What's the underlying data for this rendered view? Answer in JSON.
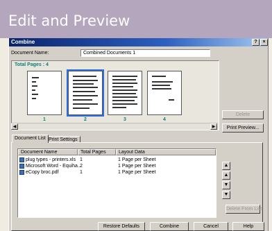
{
  "banner": {
    "title": "Edit and Preview"
  },
  "dialog": {
    "title": "Combine",
    "help_btn": "?",
    "close_btn": "×",
    "document_name_label": "Document Name:",
    "document_name_value": "Combined Documents 1",
    "total_pages_label": "Total Pages : 4",
    "thumbnails": [
      {
        "number": "1"
      },
      {
        "number": "2"
      },
      {
        "number": "3"
      },
      {
        "number": "4"
      }
    ],
    "scroll_left": "◀",
    "scroll_right": "▶",
    "delete_btn": "Delete",
    "print_preview_btn": "Print Preview...",
    "tabs": [
      "Document List",
      "Print Settings"
    ],
    "list": {
      "headers": [
        "Document Name",
        "Total Pages",
        "Layout Data"
      ],
      "rows": [
        {
          "name": "plug types - printers.xls",
          "pages": "1",
          "layout": "1 Page per Sheet"
        },
        {
          "name": "Microsoft Word - Equiha...",
          "pages": "2",
          "layout": "1 Page per Sheet"
        },
        {
          "name": "eCopy broc.pdf",
          "pages": "1",
          "layout": "1 Page per Sheet"
        }
      ]
    },
    "move_buttons": [
      "▲",
      "▲",
      "▼",
      "▼"
    ],
    "delete_from_list_btn": "Delete From List",
    "bottom_buttons": [
      "Restore Defaults",
      "Combine",
      "Cancel",
      "Help"
    ]
  }
}
